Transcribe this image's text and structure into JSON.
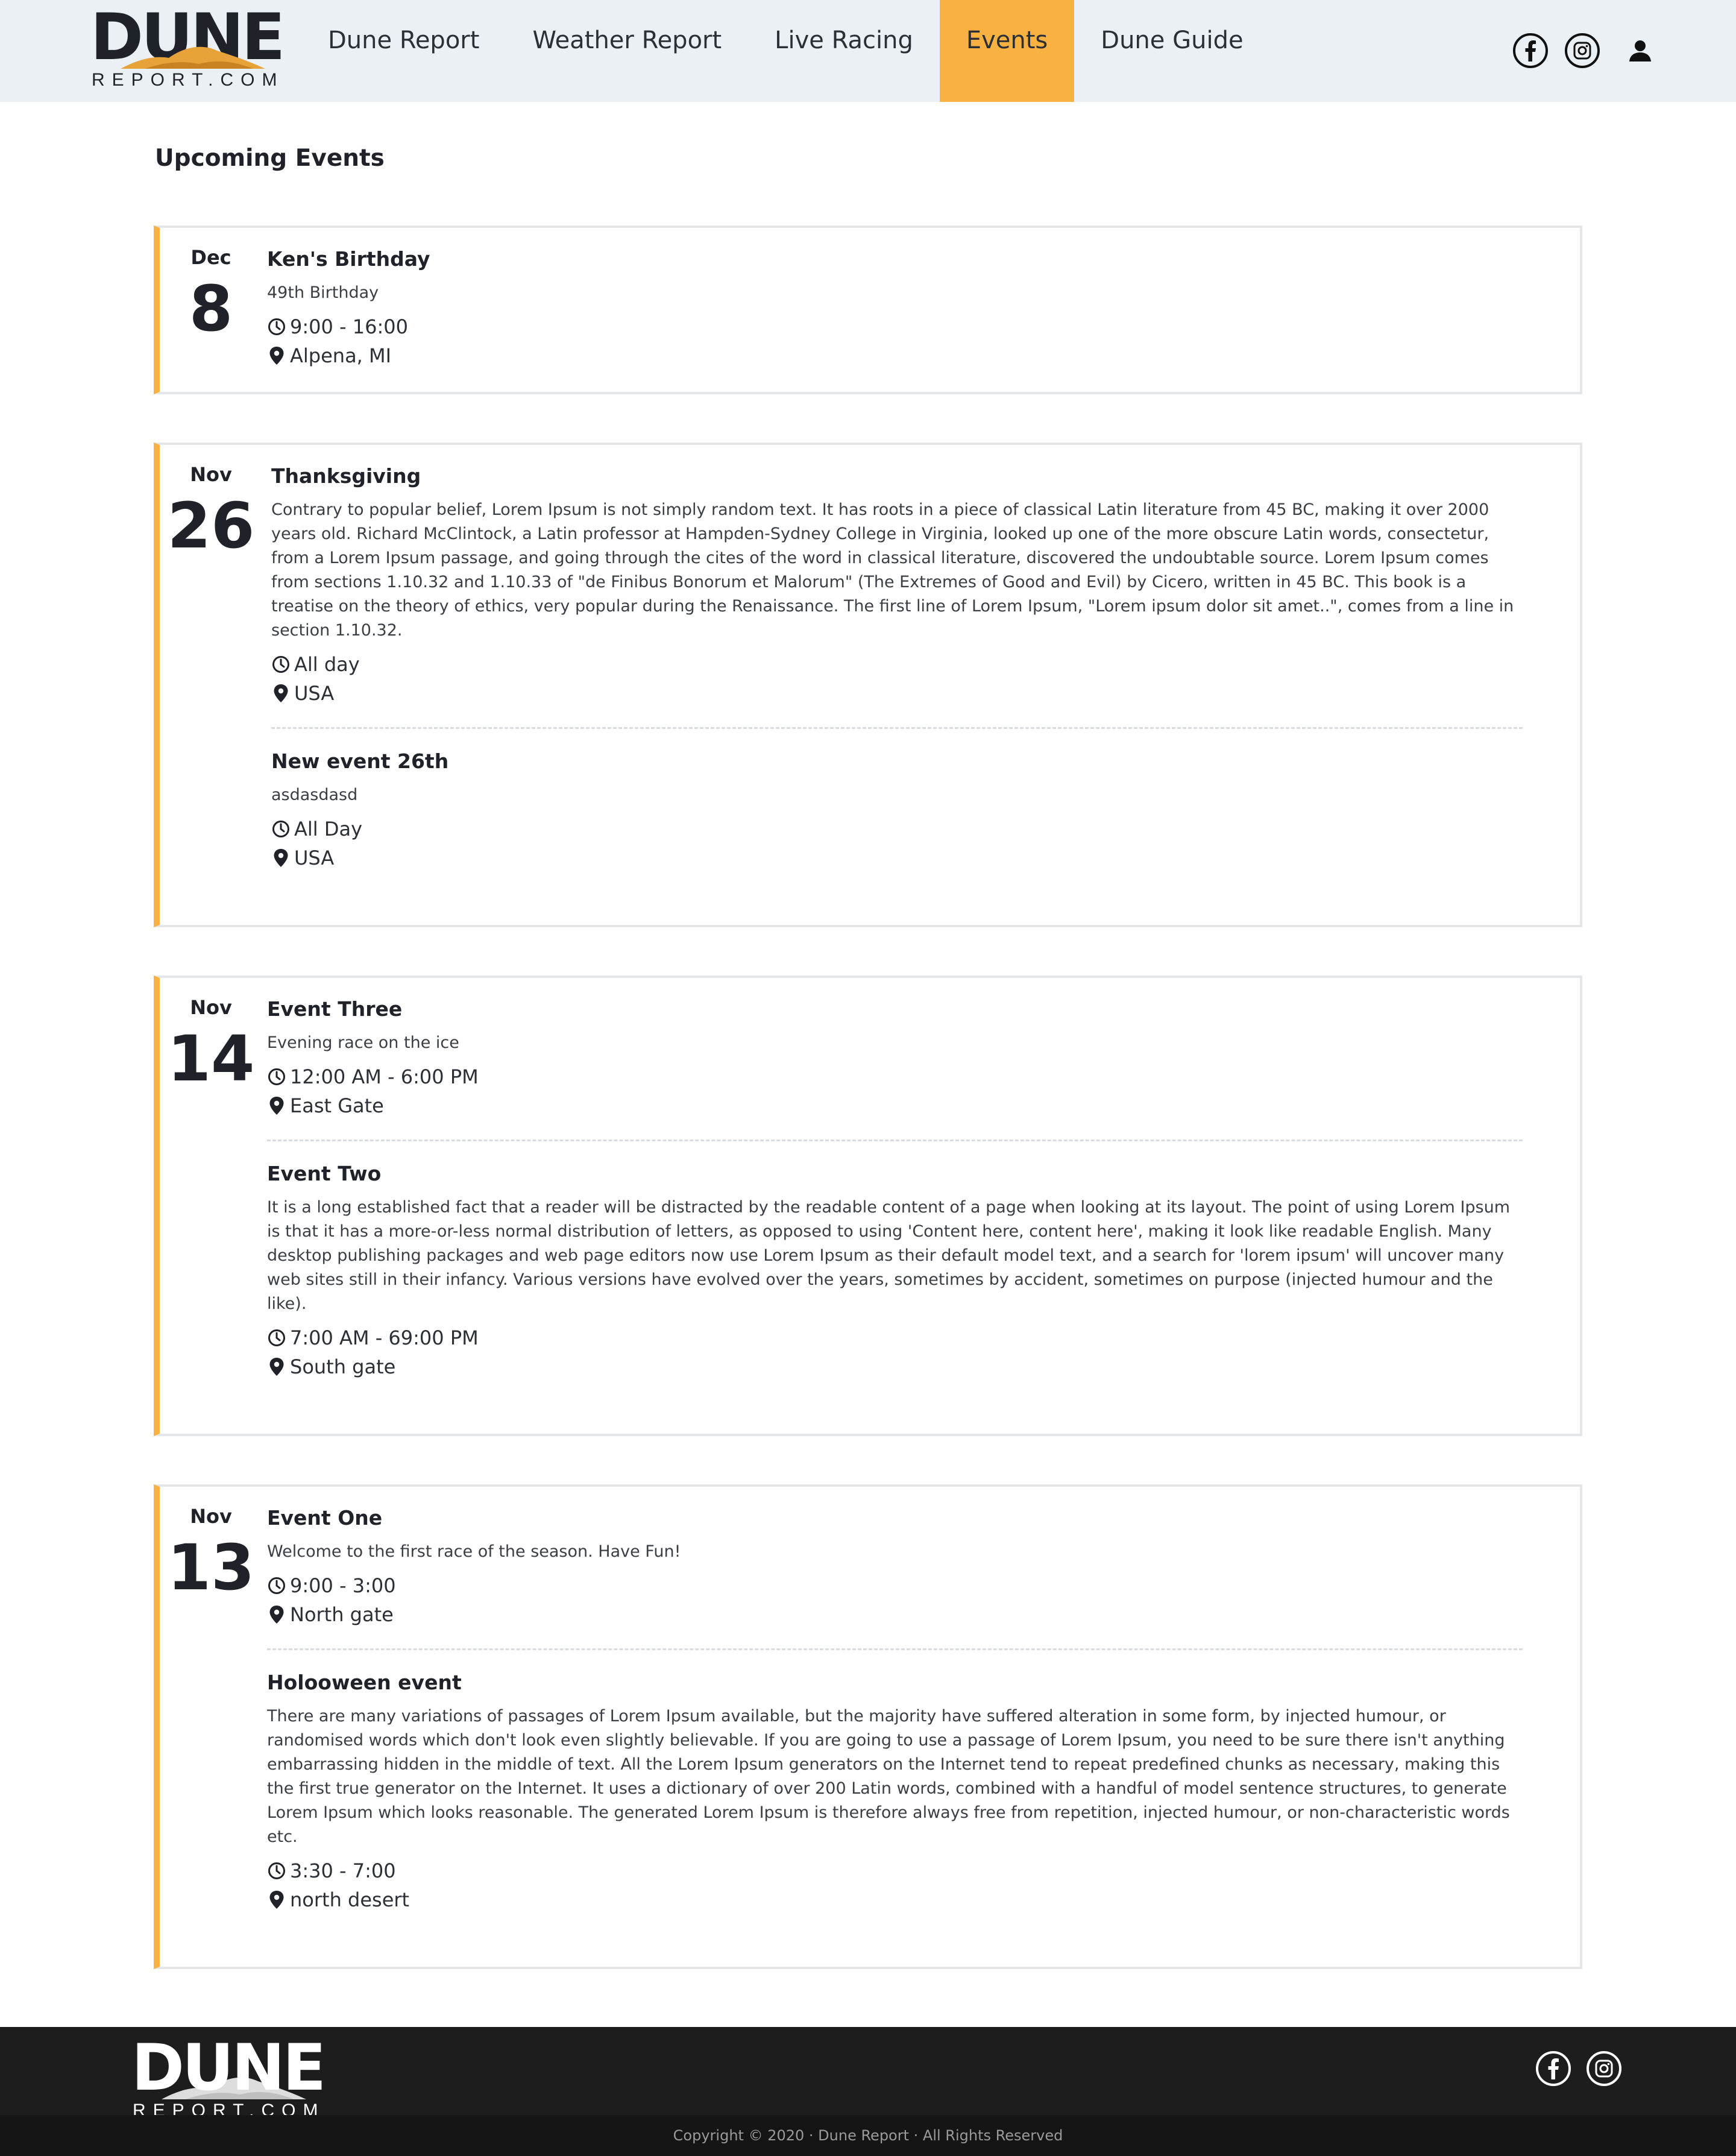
{
  "header": {
    "logo_main": "DUNE",
    "logo_sub": "REPORT.COM",
    "nav": [
      {
        "label": "Dune Report"
      },
      {
        "label": "Weather Report"
      },
      {
        "label": "Live Racing"
      },
      {
        "label": "Events",
        "active": true
      },
      {
        "label": "Dune Guide"
      }
    ],
    "icons": [
      "facebook-icon",
      "instagram-icon",
      "user-icon"
    ]
  },
  "page_title": "Upcoming Events",
  "events": [
    {
      "month": "Dec",
      "day": "8",
      "items": [
        {
          "title": "Ken's Birthday",
          "description": "49th Birthday",
          "time": "9:00 - 16:00",
          "location": "Alpena, MI"
        }
      ]
    },
    {
      "month": "Nov",
      "day": "26",
      "items": [
        {
          "title": "Thanksgiving",
          "description": "Contrary to popular belief, Lorem Ipsum is not simply random text. It has roots in a piece of classical Latin literature from 45 BC, making it over 2000 years old. Richard McClintock, a Latin professor at Hampden-Sydney College in Virginia, looked up one of the more obscure Latin words, consectetur, from a Lorem Ipsum passage, and going through the cites of the word in classical literature, discovered the undoubtable source. Lorem Ipsum comes from sections 1.10.32 and 1.10.33 of \"de Finibus Bonorum et Malorum\" (The Extremes of Good and Evil) by Cicero, written in 45 BC. This book is a treatise on the theory of ethics, very popular during the Renaissance. The first line of Lorem Ipsum, \"Lorem ipsum dolor sit amet..\", comes from a line in section 1.10.32.",
          "time": "All day",
          "location": "USA"
        },
        {
          "title": "New event 26th",
          "description": "asdasdasd",
          "time": "All Day",
          "location": "USA"
        }
      ]
    },
    {
      "month": "Nov",
      "day": "14",
      "items": [
        {
          "title": "Event Three",
          "description": "Evening race on the ice",
          "time": "12:00 AM - 6:00 PM",
          "location": "East Gate"
        },
        {
          "title": "Event Two",
          "description": "It is a long established fact that a reader will be distracted by the readable content of a page when looking at its layout. The point of using Lorem Ipsum is that it has a more-or-less normal distribution of letters, as opposed to using 'Content here, content here', making it look like readable English. Many desktop publishing packages and web page editors now use Lorem Ipsum as their default model text, and a search for 'lorem ipsum' will uncover many web sites still in their infancy. Various versions have evolved over the years, sometimes by accident, sometimes on purpose (injected humour and the like).",
          "time": "7:00 AM - 69:00 PM",
          "location": "South gate"
        }
      ]
    },
    {
      "month": "Nov",
      "day": "13",
      "items": [
        {
          "title": "Event One",
          "description": "Welcome to the first race of the season. Have Fun!",
          "time": "9:00 - 3:00",
          "location": "North gate"
        },
        {
          "title": "Holooween event",
          "description": "There are many variations of passages of Lorem Ipsum available, but the majority have suffered alteration in some form, by injected humour, or randomised words which don't look even slightly believable. If you are going to use a passage of Lorem Ipsum, you need to be sure there isn't anything embarrassing hidden in the middle of text. All the Lorem Ipsum generators on the Internet tend to repeat predefined chunks as necessary, making this the first true generator on the Internet. It uses a dictionary of over 200 Latin words, combined with a handful of model sentence structures, to generate Lorem Ipsum which looks reasonable. The generated Lorem Ipsum is therefore always free from repetition, injected humour, or non-characteristic words etc.",
          "time": "3:30 - 7:00",
          "location": "north desert"
        }
      ]
    }
  ],
  "footer": {
    "logo_main": "DUNE",
    "logo_sub": "REPORT.COM",
    "copyright": "Copyright © 2020 · Dune Report · All Rights Reserved"
  },
  "colors": {
    "accent": "#f9b242",
    "header_bg": "#ebf0f4",
    "footer_bg": "#1d1d1d"
  }
}
